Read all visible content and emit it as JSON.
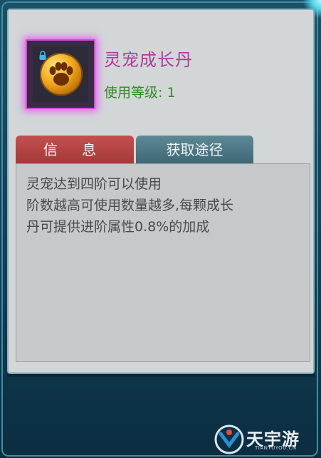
{
  "item": {
    "name": "灵宠成长丹",
    "level_label": "使用等级: 1",
    "icon": "paw-orb-icon"
  },
  "tabs": {
    "info": "信 息",
    "source": "获取途径",
    "active": "info"
  },
  "description": {
    "lines": [
      "灵宠达到四阶可以使用",
      "阶数越高可使用数量越多,每颗成长",
      "丹可提供进阶属性0.8%的加成"
    ]
  },
  "watermark": {
    "text": "天宇游",
    "sub": "TIANYUYOU.CN"
  },
  "colors": {
    "title": "#b0399c",
    "level": "#2f8a23",
    "tab_active": "#a33838",
    "tab_inactive": "#3d6775"
  }
}
